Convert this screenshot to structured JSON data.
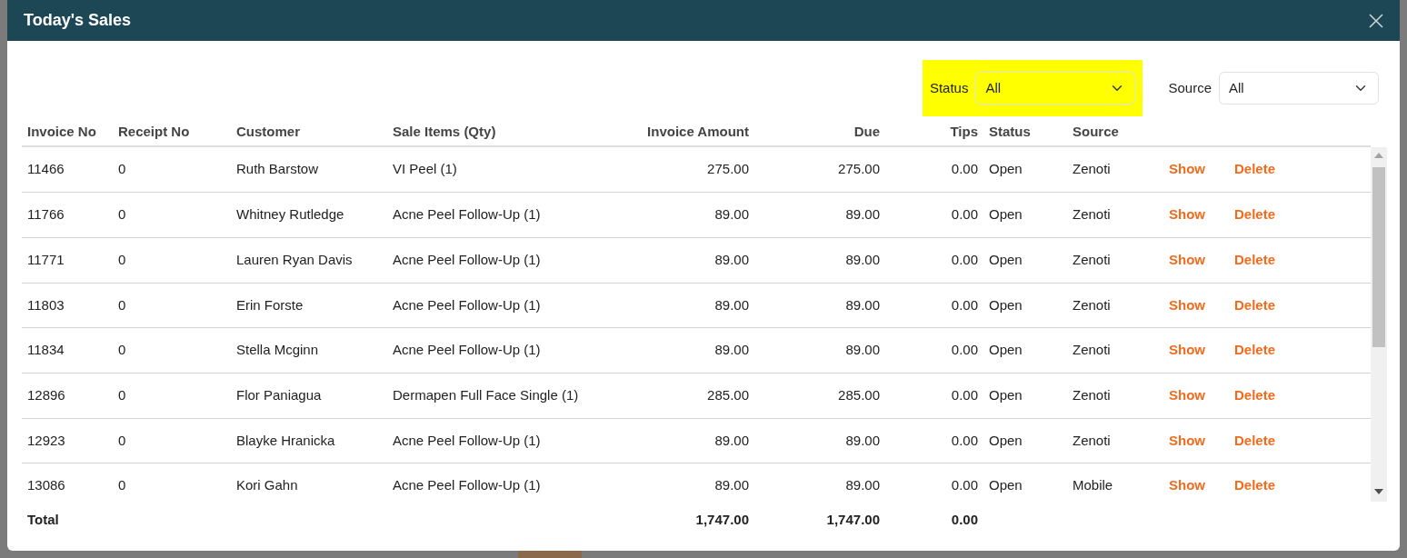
{
  "modal": {
    "title": "Today's Sales"
  },
  "filters": [
    {
      "label": "Status",
      "value": "All",
      "highlighted": true
    },
    {
      "label": "Source",
      "value": "All",
      "highlighted": false
    }
  ],
  "table": {
    "columns": [
      {
        "label": "Invoice No"
      },
      {
        "label": "Receipt No"
      },
      {
        "label": "Customer"
      },
      {
        "label": "Sale Items (Qty)"
      },
      {
        "label": "Invoice Amount"
      },
      {
        "label": "Due"
      },
      {
        "label": "Tips"
      },
      {
        "label": "Status"
      },
      {
        "label": "Source"
      }
    ],
    "rows": [
      {
        "invoice_no": "11466",
        "receipt_no": "0",
        "customer": "Ruth Barstow",
        "sale_items": "VI Peel (1)",
        "invoice_amount": "275.00",
        "due": "275.00",
        "tips": "0.00",
        "status": "Open",
        "source": "Zenoti",
        "actions": [
          "Show",
          "Delete"
        ]
      },
      {
        "invoice_no": "11766",
        "receipt_no": "0",
        "customer": "Whitney Rutledge",
        "sale_items": "Acne Peel Follow-Up (1)",
        "invoice_amount": "89.00",
        "due": "89.00",
        "tips": "0.00",
        "status": "Open",
        "source": "Zenoti",
        "actions": [
          "Show",
          "Delete"
        ]
      },
      {
        "invoice_no": "11771",
        "receipt_no": "0",
        "customer": "Lauren Ryan Davis",
        "sale_items": "Acne Peel Follow-Up (1)",
        "invoice_amount": "89.00",
        "due": "89.00",
        "tips": "0.00",
        "status": "Open",
        "source": "Zenoti",
        "actions": [
          "Show",
          "Delete"
        ]
      },
      {
        "invoice_no": "11803",
        "receipt_no": "0",
        "customer": "Erin Forste",
        "sale_items": "Acne Peel Follow-Up (1)",
        "invoice_amount": "89.00",
        "due": "89.00",
        "tips": "0.00",
        "status": "Open",
        "source": "Zenoti",
        "actions": [
          "Show",
          "Delete"
        ]
      },
      {
        "invoice_no": "11834",
        "receipt_no": "0",
        "customer": "Stella Mcginn",
        "sale_items": "Acne Peel Follow-Up (1)",
        "invoice_amount": "89.00",
        "due": "89.00",
        "tips": "0.00",
        "status": "Open",
        "source": "Zenoti",
        "actions": [
          "Show",
          "Delete"
        ]
      },
      {
        "invoice_no": "12896",
        "receipt_no": "0",
        "customer": "Flor Paniagua",
        "sale_items": "Dermapen Full Face Single (1)",
        "invoice_amount": "285.00",
        "due": "285.00",
        "tips": "0.00",
        "status": "Open",
        "source": "Zenoti",
        "actions": [
          "Show",
          "Delete"
        ]
      },
      {
        "invoice_no": "12923",
        "receipt_no": "0",
        "customer": "Blayke Hranicka",
        "sale_items": "Acne Peel Follow-Up (1)",
        "invoice_amount": "89.00",
        "due": "89.00",
        "tips": "0.00",
        "status": "Open",
        "source": "Zenoti",
        "actions": [
          "Show",
          "Delete"
        ]
      },
      {
        "invoice_no": "13086",
        "receipt_no": "0",
        "customer": "Kori Gahn",
        "sale_items": "Acne Peel Follow-Up (1)",
        "invoice_amount": "89.00",
        "due": "89.00",
        "tips": "0.00",
        "status": "Open",
        "source": "Mobile",
        "actions": [
          "Show",
          "Delete"
        ]
      }
    ],
    "total": {
      "label": "Total",
      "invoice_amount": "1,747.00",
      "due": "1,747.00",
      "tips": "0.00"
    }
  }
}
